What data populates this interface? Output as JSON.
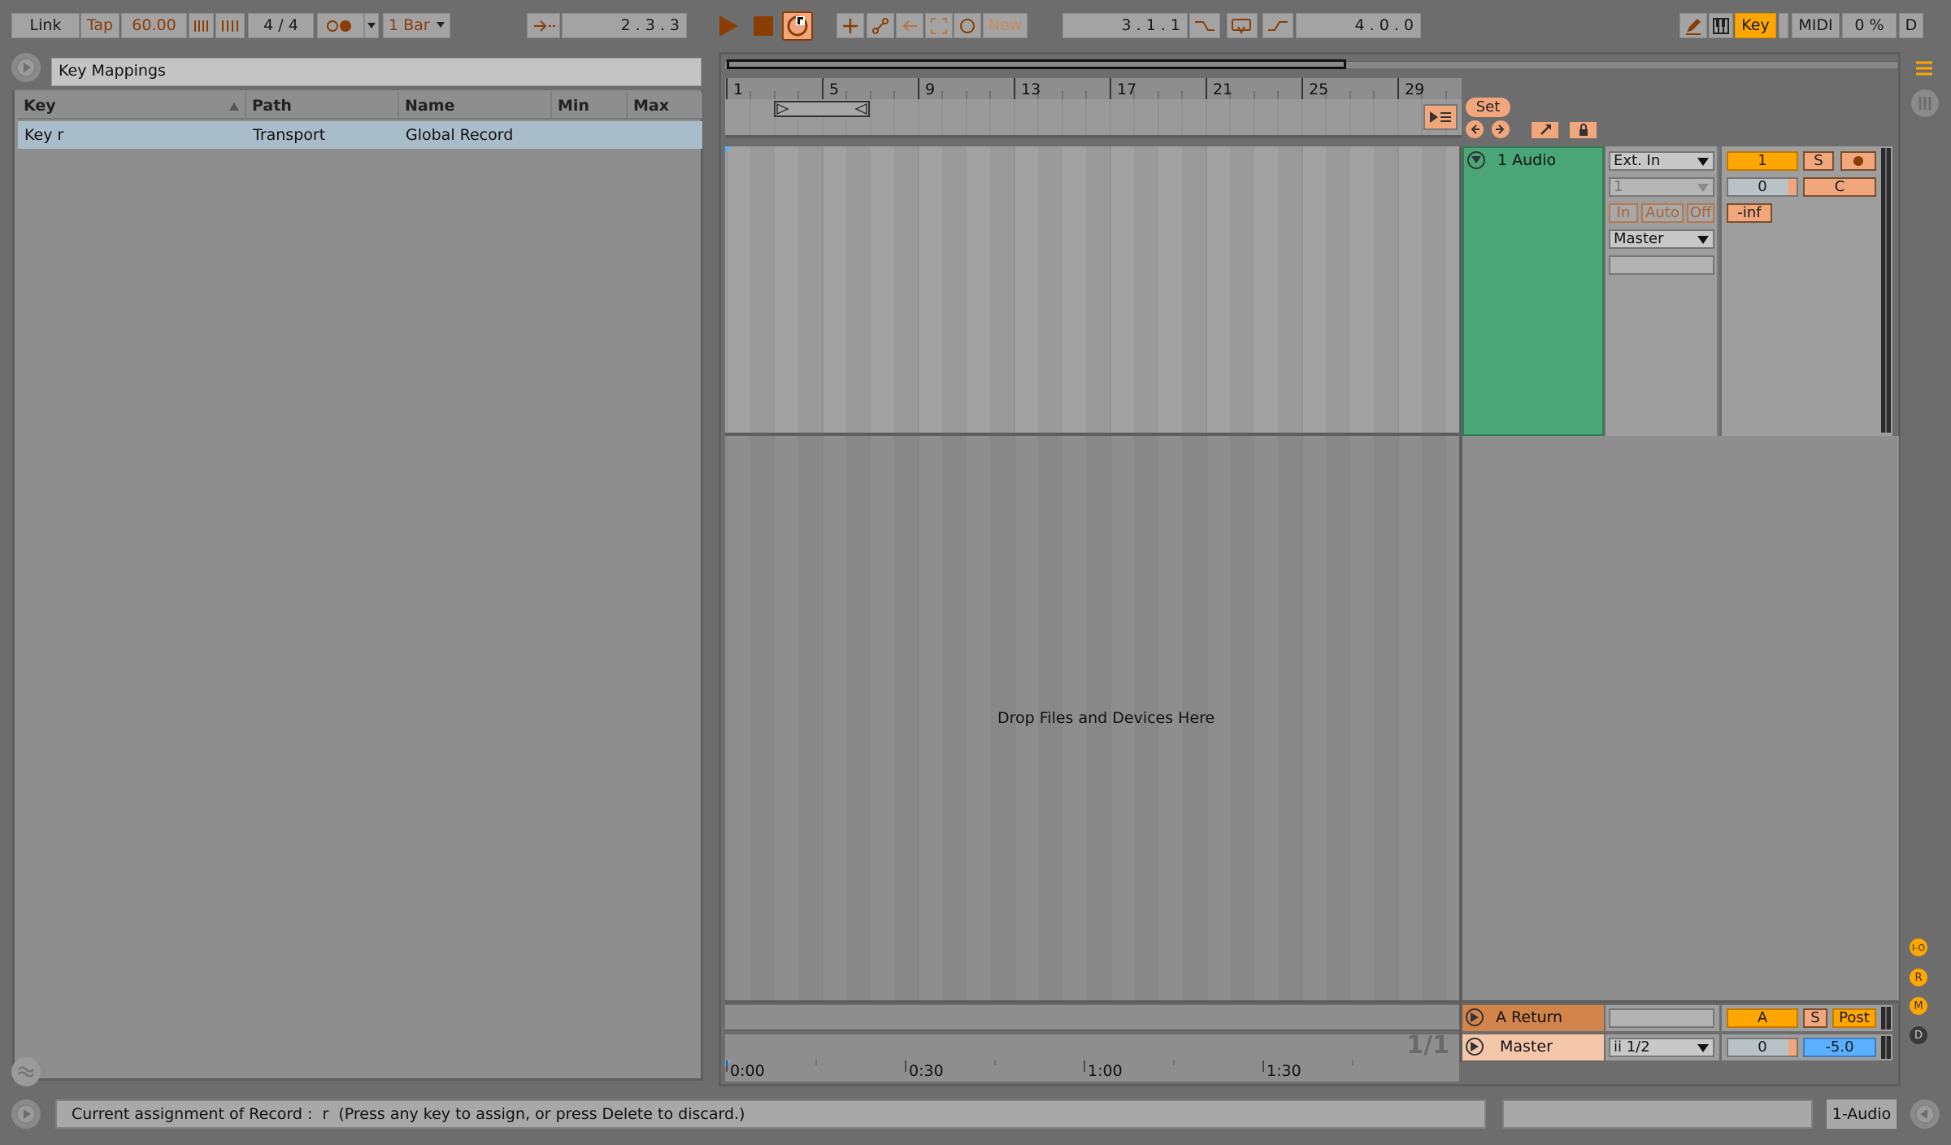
{
  "control_bar": {
    "link": "Link",
    "tap": "Tap",
    "tempo": "60.00",
    "time_signature": "4  /  4",
    "quantization": "1 Bar",
    "arrangement_position": "2 .   3 .   3",
    "new": "New",
    "loop_start": "3 .   1 .   1",
    "loop_length": "4 .   0 .   0",
    "key": "Key",
    "midi": "MIDI",
    "cpu": "0 %",
    "disk": "D"
  },
  "key_mappings": {
    "title": "Key Mappings",
    "columns": [
      "Key",
      "Path",
      "Name",
      "Min",
      "Max"
    ],
    "rows": [
      {
        "key": "Key r",
        "path": "Transport",
        "name": "Global Record",
        "min": "",
        "max": ""
      }
    ]
  },
  "arrangement": {
    "bars": [
      "1",
      "5",
      "9",
      "13",
      "17",
      "21",
      "25",
      "29"
    ],
    "set_label": "Set",
    "drop_hint": "Drop Files and Devices Here",
    "zoom": "1/1",
    "time_marks": [
      "0:00",
      "0:30",
      "1:00",
      "1:30"
    ]
  },
  "tracks": {
    "audio": {
      "name": "1 Audio",
      "input_type": "Ext. In",
      "input_channel": "1",
      "monitor": [
        "In",
        "Auto",
        "Off"
      ],
      "output": "Master",
      "track_number": "1",
      "solo": "S",
      "volume": "0",
      "pan": "C",
      "peak": "-inf"
    },
    "return": {
      "name": "A Return",
      "letter": "A",
      "solo": "S",
      "post": "Post"
    },
    "master": {
      "name": "Master",
      "cue_out": "ii 1/2",
      "volume": "0",
      "level": "-5.0"
    }
  },
  "side_buttons": [
    "I-O",
    "R",
    "M",
    "D"
  ],
  "status": {
    "message": "Current assignment of Record :  r  (Press any key to assign, or press Delete to discard.)",
    "track": "1-Audio"
  },
  "colors": {
    "orange": "#ffa600",
    "audio_track": "#4aa577",
    "accent_orange": "#f1a67c",
    "selection_blue": "#a9bcc9",
    "master_level": "#5ab0ff"
  }
}
